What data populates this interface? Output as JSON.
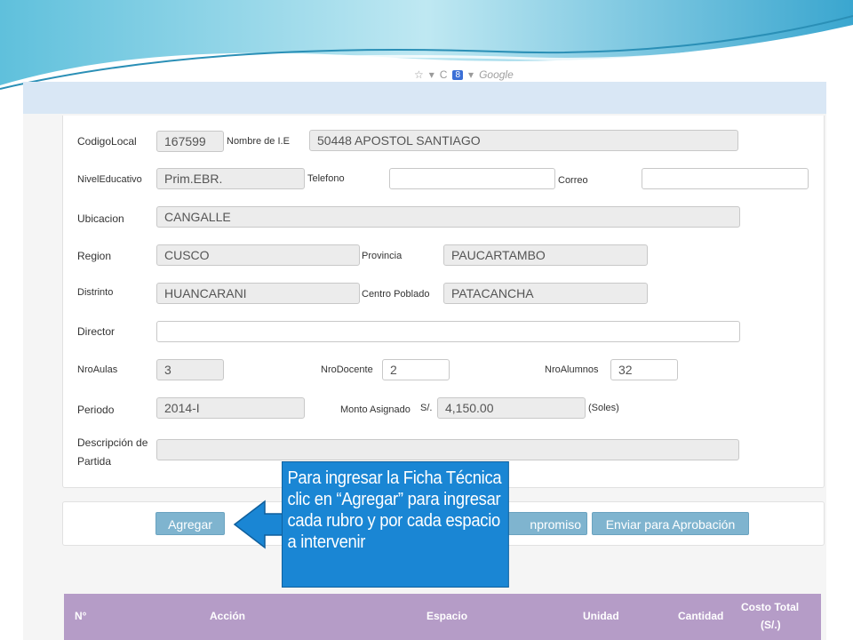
{
  "browser": {
    "search_engine": "Google"
  },
  "form": {
    "codigo_local": {
      "label": "CodigoLocal",
      "value": "167599"
    },
    "nombre_ie": {
      "label": "Nombre de I.E",
      "value": "50448 APOSTOL SANTIAGO"
    },
    "nivel_educativo": {
      "label": "NivelEducativo",
      "value": "Prim.EBR."
    },
    "telefono": {
      "label": "Telefono",
      "value": ""
    },
    "correo": {
      "label": "Correo",
      "value": ""
    },
    "ubicacion": {
      "label": "Ubicacion",
      "value": "CANGALLE"
    },
    "region": {
      "label": "Region",
      "value": "CUSCO"
    },
    "provincia": {
      "label": "Provincia",
      "value": "PAUCARTAMBO"
    },
    "distrito": {
      "label": "Distrinto",
      "value": "HUANCARANI"
    },
    "centro_poblado": {
      "label": "Centro Poblado",
      "value": "PATACANCHA"
    },
    "director": {
      "label": "Director",
      "value": ""
    },
    "nro_aulas": {
      "label": "NroAulas",
      "value": "3"
    },
    "nro_docente": {
      "label": "NroDocente",
      "value": "2"
    },
    "nro_alumnos": {
      "label": "NroAlumnos",
      "value": "32"
    },
    "periodo": {
      "label": "Periodo",
      "value": "2014-I"
    },
    "monto_asignado": {
      "label": "Monto Asignado",
      "currency": "S/.",
      "value": "4,150.00",
      "unit": "(Soles)"
    },
    "descripcion_partida": {
      "label_line1": "Descripción de",
      "label_line2": "Partida",
      "value": ""
    }
  },
  "actions": {
    "agregar": "Agregar",
    "compromiso_partial": "npromiso",
    "enviar": "Enviar para Aprobación"
  },
  "callout": {
    "text": "Para ingresar la Ficha Técnica clic en “Agregar” para ingresar cada rubro y por cada espacio a intervenir"
  },
  "table": {
    "headers": {
      "n": "N°",
      "accion": "Acción",
      "espacio": "Espacio",
      "unidad": "Unidad",
      "cantidad": "Cantidad",
      "costo_total_line1": "Costo Total",
      "costo_total_line2": "(S/.)"
    }
  },
  "colors": {
    "button": "#7fb4cf",
    "callout": "#1a86d4",
    "table_header": "#b59cc7",
    "top_bar": "#d9e7f5"
  }
}
